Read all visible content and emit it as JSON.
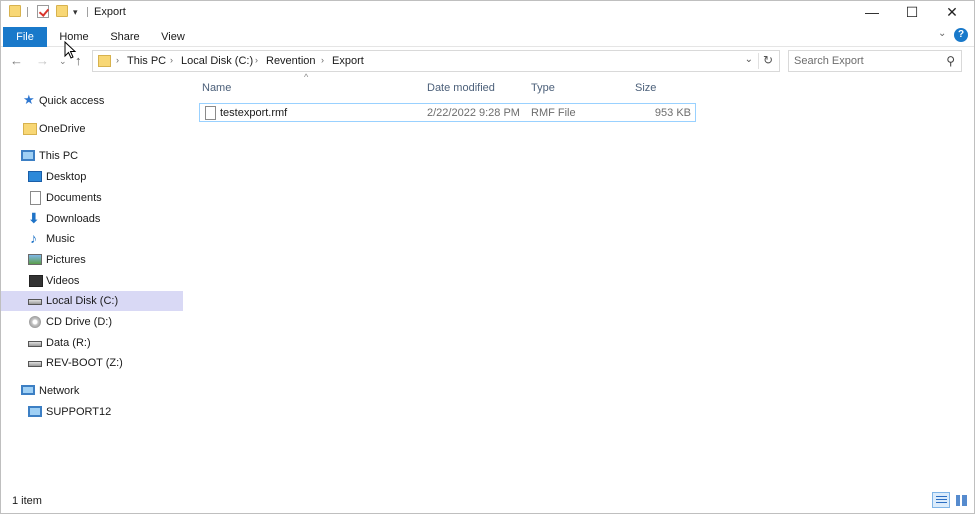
{
  "window": {
    "title": "Export",
    "controls": {
      "minimize": "—",
      "maximize": "☐",
      "close": "✕"
    }
  },
  "ribbon": {
    "tabs": [
      {
        "label": "File",
        "active": true
      },
      {
        "label": "Home"
      },
      {
        "label": "Share"
      },
      {
        "label": "View"
      }
    ],
    "expand_glyph": "⌄",
    "help_glyph": "?"
  },
  "address": {
    "crumbs": [
      "This PC",
      "Local Disk (C:)",
      "Revention",
      "Export"
    ],
    "separator": "›",
    "dropdown_glyph": "⌄",
    "refresh_glyph": "↻"
  },
  "nav_buttons": {
    "back": "←",
    "forward": "→",
    "recent": "⌄",
    "up": "↑"
  },
  "search": {
    "placeholder": "Search Export",
    "icon_glyph": "⚲"
  },
  "sidebar": {
    "items": [
      {
        "label": "Quick access",
        "icon": "star-icon"
      },
      {
        "label": "OneDrive",
        "icon": "folder-icon"
      },
      {
        "label": "This PC",
        "icon": "monitor-icon"
      },
      {
        "label": "Desktop",
        "icon": "desktop-icon"
      },
      {
        "label": "Documents",
        "icon": "document-icon"
      },
      {
        "label": "Downloads",
        "icon": "download-icon"
      },
      {
        "label": "Music",
        "icon": "music-icon"
      },
      {
        "label": "Pictures",
        "icon": "picture-icon"
      },
      {
        "label": "Videos",
        "icon": "video-icon"
      },
      {
        "label": "Local Disk (C:)",
        "icon": "drive-icon",
        "selected": true
      },
      {
        "label": "CD Drive (D:)",
        "icon": "cd-icon"
      },
      {
        "label": "Data (R:)",
        "icon": "drive-icon"
      },
      {
        "label": "REV-BOOT (Z:)",
        "icon": "drive-icon"
      },
      {
        "label": "Network",
        "icon": "network-icon"
      },
      {
        "label": "SUPPORT12",
        "icon": "computer-icon"
      }
    ],
    "star_glyph": "★",
    "download_glyph": "⬇",
    "music_glyph": "♪"
  },
  "columns": {
    "headers": [
      "Name",
      "Date modified",
      "Type",
      "Size"
    ],
    "sort_glyph": "^"
  },
  "files": [
    {
      "name": "testexport.rmf",
      "date_modified": "2/22/2022 9:28 PM",
      "type": "RMF File",
      "size": "953 KB"
    }
  ],
  "status": {
    "item_count": "1 item"
  }
}
